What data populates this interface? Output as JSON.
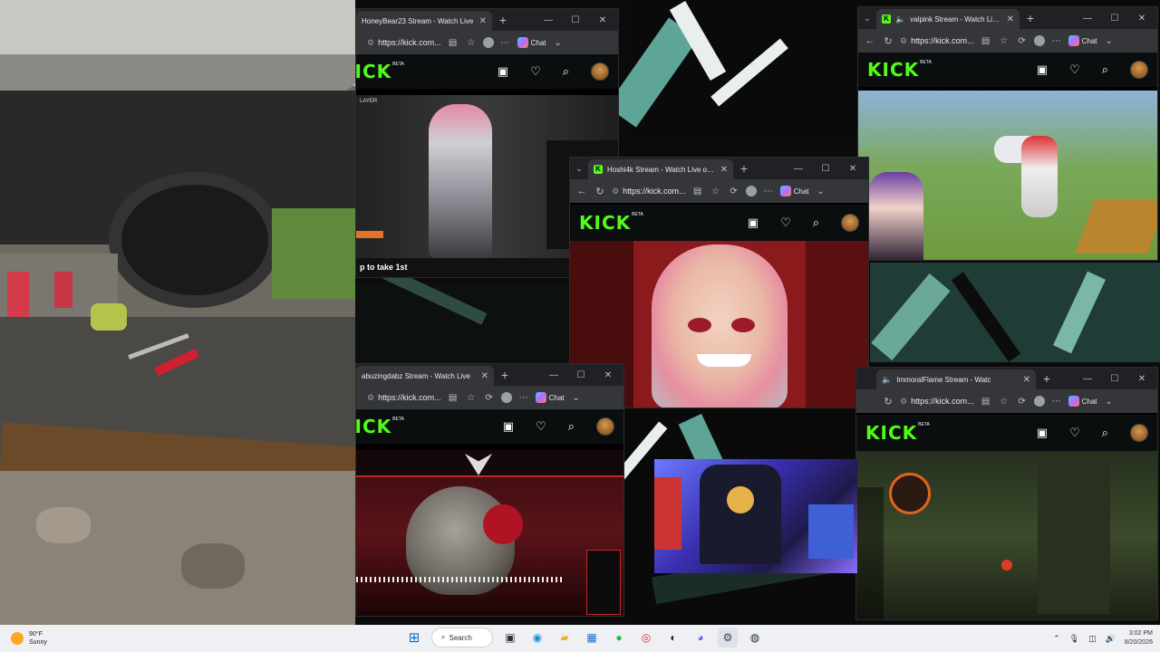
{
  "windows": {
    "honeybear": {
      "tab_title": "HoneyBear23 Stream - Watch Live",
      "url": "https://kick.com...",
      "chat_label": "Chat",
      "stream_caption": "p to take 1st",
      "hud_label": "LAYER"
    },
    "hoshi": {
      "tab_title": "Hoshi4k Stream - Watch Live on K",
      "url": "https://kick.com...",
      "chat_label": "Chat"
    },
    "valpink": {
      "tab_title": "valpink Stream - Watch Live o",
      "url": "https://kick.com...",
      "chat_label": "Chat"
    },
    "abuzing": {
      "tab_title": "abuzingdabz Stream - Watch Live",
      "url": "https://kick.com...",
      "chat_label": "Chat"
    },
    "immoral": {
      "tab_title": "ImmoralFlame Stream - Watc",
      "url": "https://kick.com...",
      "chat_label": "Chat"
    }
  },
  "kick": {
    "logo": "KICK",
    "beta": "BETA"
  },
  "taskbar": {
    "temperature": "90°F",
    "condition": "Sunny",
    "search_label": "Search",
    "time": "3:02 PM",
    "date": "8/20/2026"
  },
  "colors": {
    "kick_green": "#53fc18",
    "taskbar_bg": "#eef0f3",
    "browser_chrome": "#35363a"
  },
  "icons": [
    "windows-start-icon",
    "search-icon",
    "task-view-icon",
    "edge-icon",
    "file-explorer-icon",
    "store-icon",
    "spotify-icon",
    "chrome-icon",
    "media-icon",
    "discord-icon",
    "settings-icon",
    "steam-icon"
  ]
}
